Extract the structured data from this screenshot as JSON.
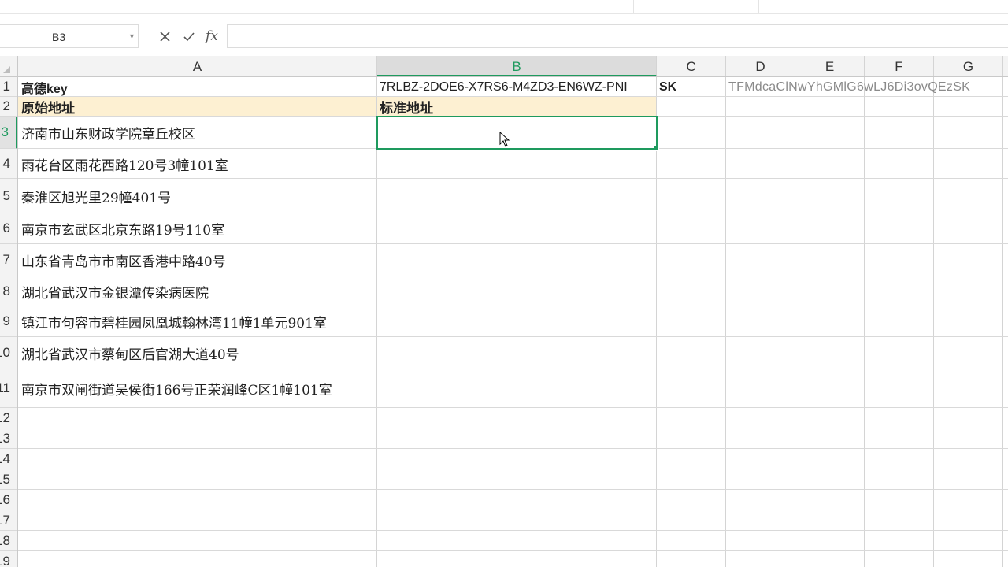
{
  "formula_bar": {
    "name_box": "B3",
    "cancel_icon": "x-icon",
    "confirm_icon": "check-icon",
    "fx_label": "fx",
    "formula": ""
  },
  "columns": [
    "A",
    "B",
    "C",
    "D",
    "E",
    "F",
    "G"
  ],
  "selected_column": "B",
  "rows": [
    "1",
    "2",
    "3",
    "4",
    "5",
    "6",
    "7",
    "8",
    "9",
    "10",
    "11",
    "12",
    "13",
    "14",
    "15",
    "16",
    "17",
    "18",
    "19"
  ],
  "selected_row": "3",
  "cells": {
    "A1": "高德key",
    "B1": "7RLBZ-2DOE6-X7RS6-M4ZD3-EN6WZ-PNI",
    "C1": "SK",
    "D1": "TFMdcaClNwYhGMlG6wLJ6Di3ovQEzSK",
    "A2": "原始地址",
    "B2": "标准地址",
    "A3": "济南市山东财政学院章丘校区",
    "A4": "雨花台区雨花西路120号3幢101室",
    "A5": "秦淮区旭光里29幢401号",
    "A6": "南京市玄武区北京东路19号110室",
    "A7": "山东省青岛市市南区香港中路40号",
    "A8": "湖北省武汉市金银潭传染病医院",
    "A9": "镇江市句容市碧桂园凤凰城翰林湾11幢1单元901室",
    "A10": "湖北省武汉市蔡甸区后官湖大道40号",
    "A11": "南京市双闸街道吴侯街166号正荣润峰C区1幢101室"
  },
  "colors": {
    "accent": "#1e9a5e",
    "header_band": "#fdf0d2"
  }
}
